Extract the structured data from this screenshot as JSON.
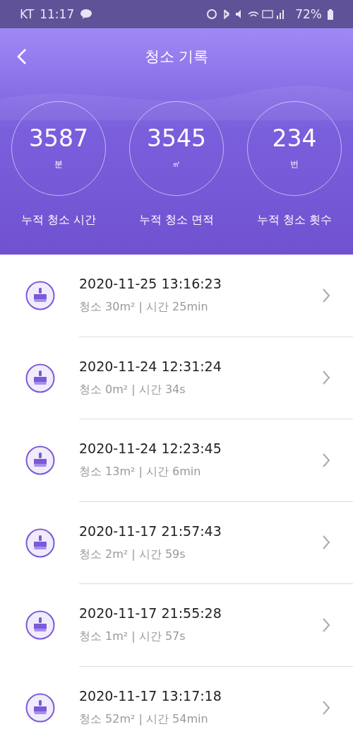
{
  "status_bar": {
    "carrier": "KT",
    "time": "11:17",
    "battery": "72%"
  },
  "header": {
    "title": "청소 기록"
  },
  "stats": [
    {
      "value": "3587",
      "unit": "분",
      "label": "누적 청소 시간"
    },
    {
      "value": "3545",
      "unit": "㎡",
      "label": "누적 청소 면적"
    },
    {
      "value": "234",
      "unit": "번",
      "label": "누적 청소 횟수"
    }
  ],
  "records": [
    {
      "datetime": "2020-11-25 13:16:23",
      "summary": "청소 30m² | 시간 25min"
    },
    {
      "datetime": "2020-11-24 12:31:24",
      "summary": "청소 0m² | 시간 34s"
    },
    {
      "datetime": "2020-11-24 12:23:45",
      "summary": "청소 13m² | 시간 6min"
    },
    {
      "datetime": "2020-11-17 21:57:43",
      "summary": "청소 2m² | 시간 59s"
    },
    {
      "datetime": "2020-11-17 21:55:28",
      "summary": "청소 1m² | 시간 57s"
    },
    {
      "datetime": "2020-11-17 13:17:18",
      "summary": "청소 52m² | 시간 54min"
    }
  ]
}
